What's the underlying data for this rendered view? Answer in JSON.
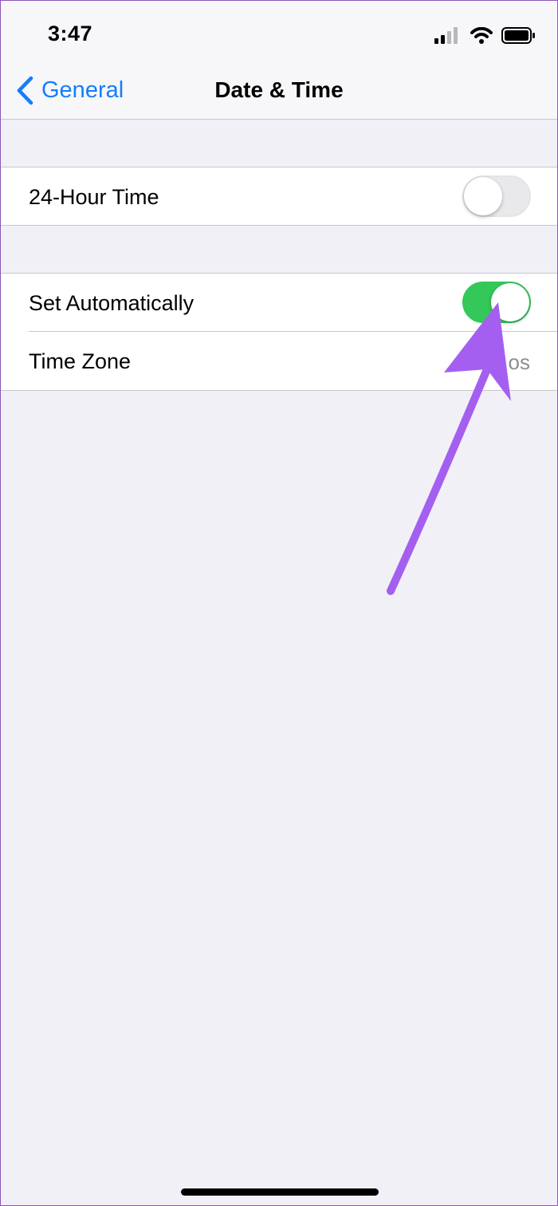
{
  "status_bar": {
    "time": "3:47",
    "icons": [
      "signal-icon",
      "wifi-icon",
      "battery-icon"
    ]
  },
  "nav": {
    "back_label": "General",
    "back_icon": "chevron-left-icon",
    "title": "Date & Time"
  },
  "settings": {
    "hour_24": {
      "label": "24-Hour Time",
      "enabled": false
    },
    "set_automatically": {
      "label": "Set Automatically",
      "enabled": true
    },
    "time_zone": {
      "label": "Time Zone",
      "value_fragment": "os"
    }
  },
  "annotation": {
    "icon": "arrow-icon",
    "color": "#a45ff0"
  },
  "colors": {
    "accent": "#147efb",
    "toggle_on": "#34c759",
    "toggle_off": "#e9e9eb",
    "background": "#f1f0f6"
  }
}
